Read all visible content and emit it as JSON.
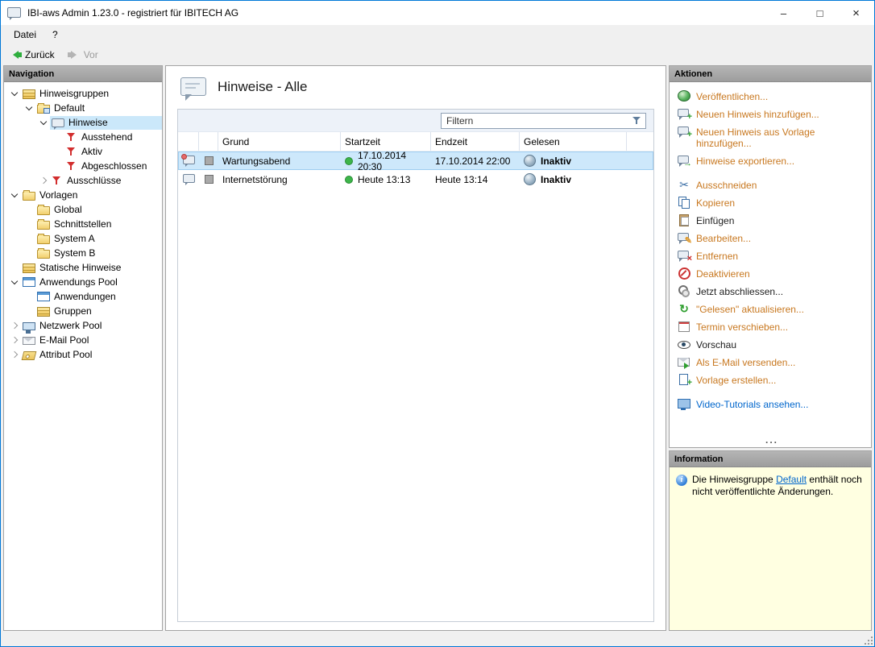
{
  "window": {
    "title": "IBI-aws Admin 1.23.0 - registriert für IBITECH AG",
    "controls": {
      "minimize": "–",
      "maximize": "□",
      "close": "×"
    }
  },
  "menu": {
    "items": [
      {
        "label": "Datei"
      },
      {
        "label": "?"
      }
    ]
  },
  "toolbar": {
    "back_label": "Zurück",
    "forward_label": "Vor"
  },
  "navigation": {
    "header": "Navigation",
    "tree": [
      {
        "label": "Hinweisgruppen",
        "level": 0,
        "icon": "group-stack-icon",
        "state": "expanded",
        "selected": false
      },
      {
        "label": "Default",
        "level": 1,
        "icon": "group-folder-icon",
        "state": "expanded",
        "selected": false
      },
      {
        "label": "Hinweise",
        "level": 2,
        "icon": "hint-bubble-icon",
        "state": "expanded",
        "selected": true
      },
      {
        "label": "Ausstehend",
        "level": 3,
        "icon": "filter-icon",
        "state": "leaf",
        "selected": false
      },
      {
        "label": "Aktiv",
        "level": 3,
        "icon": "filter-icon",
        "state": "leaf",
        "selected": false
      },
      {
        "label": "Abgeschlossen",
        "level": 3,
        "icon": "filter-icon",
        "state": "leaf",
        "selected": false
      },
      {
        "label": "Ausschlüsse",
        "level": 2,
        "icon": "filter-icon",
        "state": "collapsed",
        "selected": false
      },
      {
        "label": "Vorlagen",
        "level": 0,
        "icon": "folder-icon",
        "state": "expanded",
        "selected": false
      },
      {
        "label": "Global",
        "level": 1,
        "icon": "folder-icon",
        "state": "leaf",
        "selected": false
      },
      {
        "label": "Schnittstellen",
        "level": 1,
        "icon": "folder-icon",
        "state": "leaf",
        "selected": false
      },
      {
        "label": "System A",
        "level": 1,
        "icon": "folder-icon",
        "state": "leaf",
        "selected": false
      },
      {
        "label": "System B",
        "level": 1,
        "icon": "folder-icon",
        "state": "leaf",
        "selected": false
      },
      {
        "label": "Statische Hinweise",
        "level": 0,
        "icon": "group-stack-icon",
        "state": "leaf",
        "selected": false
      },
      {
        "label": "Anwendungs Pool",
        "level": 0,
        "icon": "app-window-icon",
        "state": "expanded",
        "selected": false
      },
      {
        "label": "Anwendungen",
        "level": 1,
        "icon": "app-window-icon",
        "state": "leaf",
        "selected": false
      },
      {
        "label": "Gruppen",
        "level": 1,
        "icon": "group-stack-icon",
        "state": "leaf",
        "selected": false
      },
      {
        "label": "Netzwerk Pool",
        "level": 0,
        "icon": "network-icon",
        "state": "collapsed",
        "selected": false
      },
      {
        "label": "E-Mail Pool",
        "level": 0,
        "icon": "mail-icon",
        "state": "collapsed",
        "selected": false
      },
      {
        "label": "Attribut Pool",
        "level": 0,
        "icon": "tag-icon",
        "state": "collapsed",
        "selected": false
      }
    ]
  },
  "main": {
    "title": "Hinweise - Alle",
    "filter": {
      "placeholder": "Filtern"
    },
    "table": {
      "columns": [
        "Grund",
        "Startzeit",
        "Endzeit",
        "Gelesen"
      ],
      "rows": [
        {
          "grund": "Wartungsabend",
          "startzeit": "17.10.2014 20:30",
          "endzeit": "17.10.2014 22:00",
          "gelesen": "Inaktiv",
          "selected": true
        },
        {
          "grund": "Internetstörung",
          "startzeit": "Heute 13:13",
          "endzeit": "Heute 13:14",
          "gelesen": "Inaktiv",
          "selected": false
        }
      ]
    }
  },
  "actions": {
    "header": "Aktionen",
    "items": [
      {
        "label": "Veröffentlichen...",
        "icon": "publish-icon",
        "style": "accent"
      },
      {
        "label": "Neuen Hinweis hinzufügen...",
        "icon": "add-hint-icon",
        "style": "accent"
      },
      {
        "label": "Neuen Hinweis aus Vorlage hinzufügen...",
        "icon": "add-hint-from-template-icon",
        "style": "accent"
      },
      {
        "label": "Hinweise exportieren...",
        "icon": "export-hints-icon",
        "style": "accent"
      },
      {
        "label": "Ausschneiden",
        "icon": "cut-icon",
        "style": "accent"
      },
      {
        "label": "Kopieren",
        "icon": "copy-icon",
        "style": "accent"
      },
      {
        "label": "Einfügen",
        "icon": "paste-icon",
        "style": "default"
      },
      {
        "label": "Bearbeiten...",
        "icon": "edit-icon",
        "style": "accent"
      },
      {
        "label": "Entfernen",
        "icon": "remove-icon",
        "style": "accent"
      },
      {
        "label": "Deaktivieren",
        "icon": "deactivate-icon",
        "style": "accent"
      },
      {
        "label": "Jetzt abschliessen...",
        "icon": "finish-now-icon",
        "style": "default"
      },
      {
        "label": "\"Gelesen\" aktualisieren...",
        "icon": "refresh-read-icon",
        "style": "accent"
      },
      {
        "label": "Termin verschieben...",
        "icon": "reschedule-icon",
        "style": "accent"
      },
      {
        "label": "Vorschau",
        "icon": "preview-icon",
        "style": "default"
      },
      {
        "label": "Als E-Mail versenden...",
        "icon": "send-mail-icon",
        "style": "accent"
      },
      {
        "label": "Vorlage erstellen...",
        "icon": "create-template-icon",
        "style": "accent"
      },
      {
        "label": "Video-Tutorials ansehen...",
        "icon": "video-tutorials-icon",
        "style": "link"
      }
    ],
    "more_indicator": "..."
  },
  "information": {
    "header": "Information",
    "text_before": "Die Hinweisgruppe ",
    "link_text": "Default",
    "text_after": " enthält noch nicht veröffentlichte Änderungen."
  },
  "colors": {
    "window_border": "#0078d7",
    "accent_orange": "#c87820",
    "link_blue": "#0066cc",
    "selection_blue": "#cde8fb",
    "info_bg": "#ffffe1",
    "status_green": "#3db54a",
    "filter_red": "#d22d2d"
  }
}
